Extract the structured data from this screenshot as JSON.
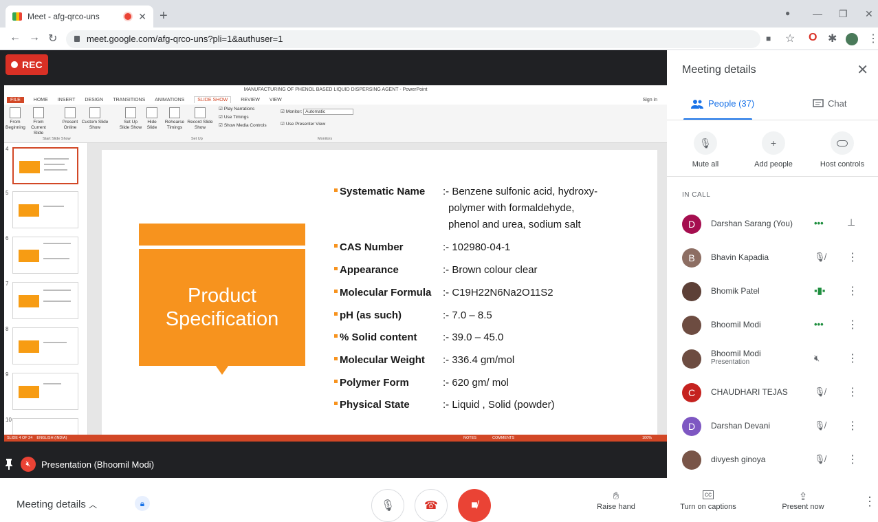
{
  "browser": {
    "tab_title": "Meet - afg-qrco-uns",
    "url": "meet.google.com/afg-qrco-uns?pli=1&authuser=1"
  },
  "meet": {
    "rec_label": "REC",
    "presentation_label": "Presentation (Bhoomil Modi)"
  },
  "ppt": {
    "window_title": "MANUFACTURING OF PHENOL BASED LIQUID DISPERSING AGENT - PowerPoint",
    "tabs": [
      "FILE",
      "HOME",
      "INSERT",
      "DESIGN",
      "TRANSITIONS",
      "ANIMATIONS",
      "SLIDE SHOW",
      "REVIEW",
      "VIEW"
    ],
    "sign_in": "Sign in",
    "ribbon": {
      "from_beginning": "From Beginning",
      "from_current": "From Current Slide",
      "present_online": "Present Online",
      "custom_show": "Custom Slide Show",
      "setup_show": "Set Up Slide Show",
      "hide_slide": "Hide Slide",
      "rehearse": "Rehearse Timings",
      "record": "Record Slide Show",
      "play_narrations": "Play Narrations",
      "use_timings": "Use Timings",
      "show_media": "Show Media Controls",
      "monitor_label": "Monitor:",
      "monitor_value": "Automatic",
      "presenter_view": "Use Presenter View",
      "grp_start": "Start Slide Show",
      "grp_setup": "Set Up",
      "grp_monitors": "Monitors"
    },
    "thumb_numbers": [
      "4",
      "5",
      "6",
      "7",
      "8",
      "9",
      "10"
    ],
    "status_left": "SLIDE 4 OF 24",
    "status_lang": "ENGLISH (INDIA)",
    "status_notes": "NOTES",
    "status_comments": "COMMENTS",
    "status_zoom": "100%",
    "slide": {
      "title_line1": "Product",
      "title_line2": "Specification",
      "specs": [
        {
          "key": "Systematic Name",
          "value": ":- Benzene sulfonic acid, hydroxy-"
        },
        {
          "key": "",
          "value": "polymer with formaldehyde,"
        },
        {
          "key": "",
          "value": "phenol and urea, sodium salt"
        },
        {
          "key": "CAS Number",
          "value": ":- 102980-04-1"
        },
        {
          "key": "Appearance",
          "value": ":- Brown colour clear"
        },
        {
          "key": "Molecular Formula",
          "value": ":- C19H22N6Na2O11S2"
        },
        {
          "key": "pH (as such)",
          "value": ":- 7.0 – 8.5"
        },
        {
          "key": "% Solid content",
          "value": ":- 39.0 – 45.0"
        },
        {
          "key": "Molecular Weight",
          "value": ":- 336.4 gm/mol"
        },
        {
          "key": "Polymer Form",
          "value": ":- 620 gm/ mol"
        },
        {
          "key": "Physical State",
          "value": ":- Liquid , Solid (powder)"
        }
      ]
    }
  },
  "panel": {
    "title": "Meeting details",
    "tab_people": "People (37)",
    "tab_chat": "Chat",
    "mute_all": "Mute all",
    "add_people": "Add people",
    "host_controls": "Host controls",
    "in_call": "IN CALL",
    "people": [
      {
        "initial": "D",
        "name": "Darshan Sarang (You)",
        "sub": "",
        "color": "#a50e4f"
      },
      {
        "initial": "B",
        "name": "Bhavin Kapadia",
        "sub": "",
        "color": "#8d6e63"
      },
      {
        "initial": "",
        "name": "Bhomik Patel",
        "sub": "",
        "color": "#5d4037"
      },
      {
        "initial": "",
        "name": "Bhoomil Modi",
        "sub": "",
        "color": "#6d4c41"
      },
      {
        "initial": "",
        "name": "Bhoomil Modi",
        "sub": "Presentation",
        "color": "#6d4c41"
      },
      {
        "initial": "C",
        "name": "CHAUDHARI TEJAS",
        "sub": "",
        "color": "#c5221f"
      },
      {
        "initial": "D",
        "name": "Darshan Devani",
        "sub": "",
        "color": "#7e57c2"
      },
      {
        "initial": "",
        "name": "divyesh ginoya",
        "sub": "",
        "color": "#795548"
      }
    ]
  },
  "bottom": {
    "meeting_details": "Meeting details",
    "raise_hand": "Raise hand",
    "captions": "Turn on captions",
    "present_now": "Present now"
  }
}
